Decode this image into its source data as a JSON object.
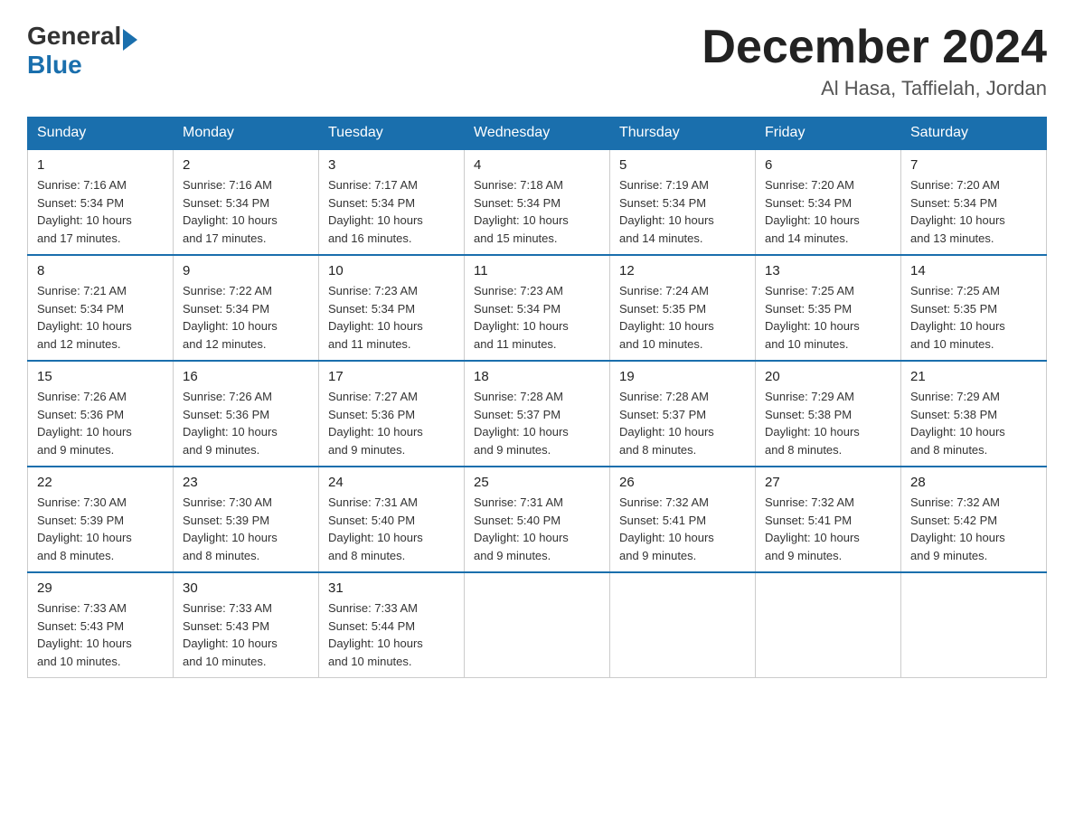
{
  "logo": {
    "general": "General",
    "blue": "Blue"
  },
  "title": "December 2024",
  "location": "Al Hasa, Taffielah, Jordan",
  "days_of_week": [
    "Sunday",
    "Monday",
    "Tuesday",
    "Wednesday",
    "Thursday",
    "Friday",
    "Saturday"
  ],
  "weeks": [
    [
      {
        "day": "1",
        "info": "Sunrise: 7:16 AM\nSunset: 5:34 PM\nDaylight: 10 hours\nand 17 minutes."
      },
      {
        "day": "2",
        "info": "Sunrise: 7:16 AM\nSunset: 5:34 PM\nDaylight: 10 hours\nand 17 minutes."
      },
      {
        "day": "3",
        "info": "Sunrise: 7:17 AM\nSunset: 5:34 PM\nDaylight: 10 hours\nand 16 minutes."
      },
      {
        "day": "4",
        "info": "Sunrise: 7:18 AM\nSunset: 5:34 PM\nDaylight: 10 hours\nand 15 minutes."
      },
      {
        "day": "5",
        "info": "Sunrise: 7:19 AM\nSunset: 5:34 PM\nDaylight: 10 hours\nand 14 minutes."
      },
      {
        "day": "6",
        "info": "Sunrise: 7:20 AM\nSunset: 5:34 PM\nDaylight: 10 hours\nand 14 minutes."
      },
      {
        "day": "7",
        "info": "Sunrise: 7:20 AM\nSunset: 5:34 PM\nDaylight: 10 hours\nand 13 minutes."
      }
    ],
    [
      {
        "day": "8",
        "info": "Sunrise: 7:21 AM\nSunset: 5:34 PM\nDaylight: 10 hours\nand 12 minutes."
      },
      {
        "day": "9",
        "info": "Sunrise: 7:22 AM\nSunset: 5:34 PM\nDaylight: 10 hours\nand 12 minutes."
      },
      {
        "day": "10",
        "info": "Sunrise: 7:23 AM\nSunset: 5:34 PM\nDaylight: 10 hours\nand 11 minutes."
      },
      {
        "day": "11",
        "info": "Sunrise: 7:23 AM\nSunset: 5:34 PM\nDaylight: 10 hours\nand 11 minutes."
      },
      {
        "day": "12",
        "info": "Sunrise: 7:24 AM\nSunset: 5:35 PM\nDaylight: 10 hours\nand 10 minutes."
      },
      {
        "day": "13",
        "info": "Sunrise: 7:25 AM\nSunset: 5:35 PM\nDaylight: 10 hours\nand 10 minutes."
      },
      {
        "day": "14",
        "info": "Sunrise: 7:25 AM\nSunset: 5:35 PM\nDaylight: 10 hours\nand 10 minutes."
      }
    ],
    [
      {
        "day": "15",
        "info": "Sunrise: 7:26 AM\nSunset: 5:36 PM\nDaylight: 10 hours\nand 9 minutes."
      },
      {
        "day": "16",
        "info": "Sunrise: 7:26 AM\nSunset: 5:36 PM\nDaylight: 10 hours\nand 9 minutes."
      },
      {
        "day": "17",
        "info": "Sunrise: 7:27 AM\nSunset: 5:36 PM\nDaylight: 10 hours\nand 9 minutes."
      },
      {
        "day": "18",
        "info": "Sunrise: 7:28 AM\nSunset: 5:37 PM\nDaylight: 10 hours\nand 9 minutes."
      },
      {
        "day": "19",
        "info": "Sunrise: 7:28 AM\nSunset: 5:37 PM\nDaylight: 10 hours\nand 8 minutes."
      },
      {
        "day": "20",
        "info": "Sunrise: 7:29 AM\nSunset: 5:38 PM\nDaylight: 10 hours\nand 8 minutes."
      },
      {
        "day": "21",
        "info": "Sunrise: 7:29 AM\nSunset: 5:38 PM\nDaylight: 10 hours\nand 8 minutes."
      }
    ],
    [
      {
        "day": "22",
        "info": "Sunrise: 7:30 AM\nSunset: 5:39 PM\nDaylight: 10 hours\nand 8 minutes."
      },
      {
        "day": "23",
        "info": "Sunrise: 7:30 AM\nSunset: 5:39 PM\nDaylight: 10 hours\nand 8 minutes."
      },
      {
        "day": "24",
        "info": "Sunrise: 7:31 AM\nSunset: 5:40 PM\nDaylight: 10 hours\nand 8 minutes."
      },
      {
        "day": "25",
        "info": "Sunrise: 7:31 AM\nSunset: 5:40 PM\nDaylight: 10 hours\nand 9 minutes."
      },
      {
        "day": "26",
        "info": "Sunrise: 7:32 AM\nSunset: 5:41 PM\nDaylight: 10 hours\nand 9 minutes."
      },
      {
        "day": "27",
        "info": "Sunrise: 7:32 AM\nSunset: 5:41 PM\nDaylight: 10 hours\nand 9 minutes."
      },
      {
        "day": "28",
        "info": "Sunrise: 7:32 AM\nSunset: 5:42 PM\nDaylight: 10 hours\nand 9 minutes."
      }
    ],
    [
      {
        "day": "29",
        "info": "Sunrise: 7:33 AM\nSunset: 5:43 PM\nDaylight: 10 hours\nand 10 minutes."
      },
      {
        "day": "30",
        "info": "Sunrise: 7:33 AM\nSunset: 5:43 PM\nDaylight: 10 hours\nand 10 minutes."
      },
      {
        "day": "31",
        "info": "Sunrise: 7:33 AM\nSunset: 5:44 PM\nDaylight: 10 hours\nand 10 minutes."
      },
      {
        "day": "",
        "info": ""
      },
      {
        "day": "",
        "info": ""
      },
      {
        "day": "",
        "info": ""
      },
      {
        "day": "",
        "info": ""
      }
    ]
  ]
}
